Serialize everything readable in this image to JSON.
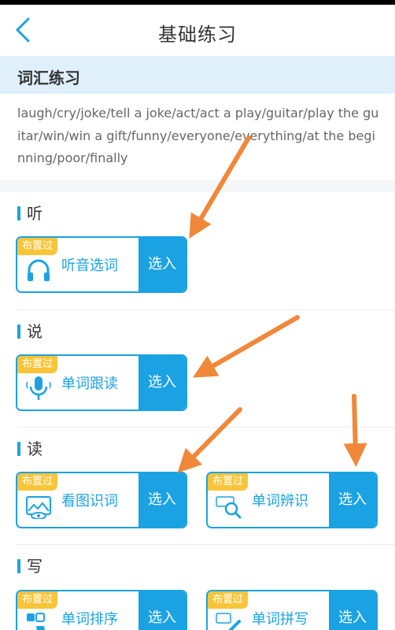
{
  "header": {
    "title": "基础练习"
  },
  "vocab_section": {
    "title": "词汇练习",
    "words": "laugh/cry/joke/tell a joke/act/act a play/guitar/play the guitar/win/win a gift/funny/everyone/everything/at the beginning/poor/finally"
  },
  "categories": [
    {
      "label": "听",
      "cards": [
        {
          "badge": "布置过",
          "label": "听音选词",
          "icon": "headphones-icon",
          "button": "选入"
        }
      ]
    },
    {
      "label": "说",
      "cards": [
        {
          "badge": "布置过",
          "label": "单词跟读",
          "icon": "microphone-icon",
          "button": "选入"
        }
      ]
    },
    {
      "label": "读",
      "cards": [
        {
          "badge": "布置过",
          "label": "看图识词",
          "icon": "picture-eye-icon",
          "button": "选入"
        },
        {
          "badge": "布置过",
          "label": "单词辨识",
          "icon": "word-magnifier-icon",
          "button": "选入"
        }
      ]
    },
    {
      "label": "写",
      "cards": [
        {
          "badge": "布置过",
          "label": "单词排序",
          "icon": "sort-hand-icon",
          "button": "选入"
        },
        {
          "badge": "布置过",
          "label": "单词拼写",
          "icon": "spelling-pencil-icon",
          "button": "选入"
        }
      ]
    }
  ],
  "colors": {
    "accent": "#1ba2e3",
    "badge": "#f8c53a",
    "annotation_arrow": "#f0883a",
    "section_bg": "#dff0fa"
  }
}
